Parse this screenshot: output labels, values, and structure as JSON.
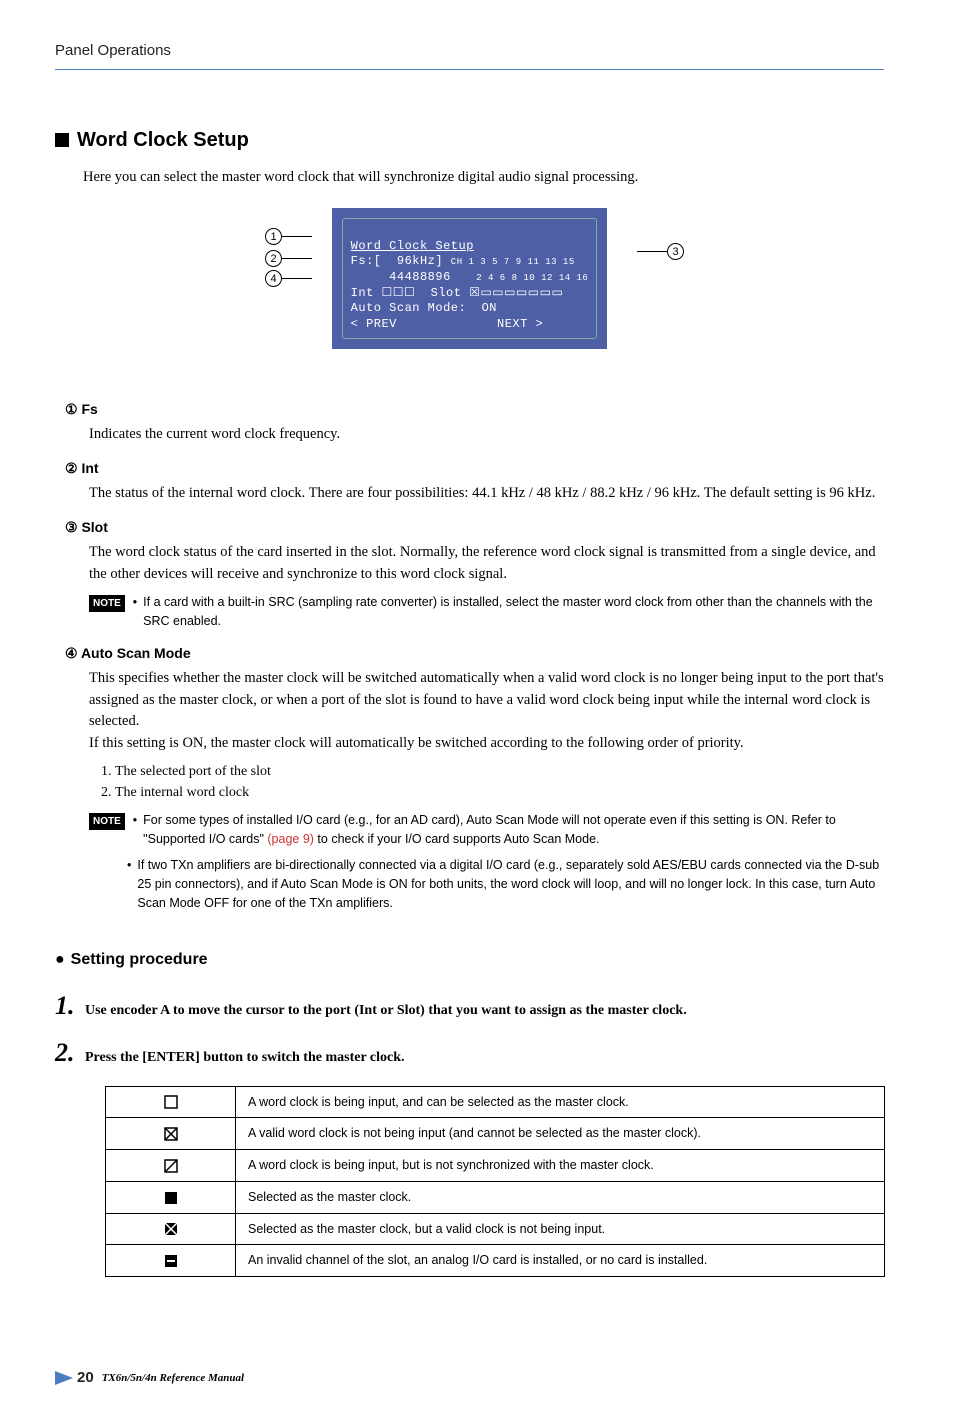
{
  "header": {
    "title": "Panel Operations"
  },
  "section": {
    "title": "Word Clock Setup",
    "intro": "Here you can select the master word clock that will synchronize digital audio signal processing."
  },
  "lcd": {
    "line1": "Word Clock Setup",
    "line2": "Fs:[  96kHz]",
    "line3a": "     44488896 ",
    "line3b_top": "CH 1 3 5 7 9 11 13 15",
    "line3b_bot": "   2 4 6 8 10 12 14 16",
    "line4a": "Int ☐☐☐",
    "line4b": "Slot ☒▭▭▭▭▭▭▭",
    "line5": "Auto Scan Mode:  ON ",
    "line6a": "< PREV",
    "line6b": "NEXT >"
  },
  "items": [
    {
      "num": "①",
      "label": "Fs",
      "body": "Indicates the current word clock frequency."
    },
    {
      "num": "②",
      "label": "Int",
      "body": "The status of the internal word clock. There are four possibilities: 44.1 kHz / 48 kHz / 88.2 kHz / 96 kHz. The default setting is 96 kHz."
    },
    {
      "num": "③",
      "label": "Slot",
      "body": "The word clock status of the card inserted in the slot. Normally, the reference word clock signal is transmitted from a single device, and the other devices will receive and synchronize to this word clock signal.",
      "note1": "If a card with a built-in SRC (sampling rate converter) is installed, select the master word clock from other than the channels with the SRC enabled."
    },
    {
      "num": "④",
      "label": "Auto Scan Mode",
      "body1": "This specifies whether the master clock will be switched automatically when a valid word clock is no longer being input to the port that's assigned as the master clock, or when a port of the slot is found to have a valid word clock being input while the internal word clock is selected.",
      "body2": "If this setting is ON, the master clock will automatically be switched according to the following order of priority.",
      "ol1": "The selected port of the slot",
      "ol2": "The internal word clock",
      "noteA_pre": "For some types of installed I/O card (e.g., for an AD card), Auto Scan Mode will not operate even if this setting is ON. Refer to \"Supported I/O cards\" ",
      "noteA_link": "(page 9)",
      "noteA_post": " to check if your I/O card supports Auto Scan Mode.",
      "noteB": "If two TXn amplifiers are bi-directionally connected via a digital I/O card (e.g., separately sold AES/EBU cards connected via the D-sub 25 pin connectors), and if Auto Scan Mode is ON for both units, the word clock will loop, and will no longer lock. In this case, turn Auto Scan Mode OFF for one of the TXn amplifiers."
    }
  ],
  "procedure": {
    "title": "Setting procedure",
    "step1": "Use encoder A to move the cursor to the port (Int or Slot) that you want to assign as the master clock.",
    "step2": "Press the [ENTER] button to switch the master clock."
  },
  "legend": [
    {
      "icon": "box-empty",
      "desc": "A word clock is being input, and can be selected as the master clock."
    },
    {
      "icon": "box-x",
      "desc": "A valid word clock is not being input (and cannot be selected as the master clock)."
    },
    {
      "icon": "box-diag",
      "desc": "A word clock is being input, but is not synchronized with the master clock."
    },
    {
      "icon": "box-fill",
      "desc": "Selected as the master clock."
    },
    {
      "icon": "box-fill-x",
      "desc": "Selected as the master clock, but a valid clock is not being input."
    },
    {
      "icon": "box-fill-dash",
      "desc": "An invalid channel of the slot, an analog I/O card is installed, or no card is installed."
    }
  ],
  "footer": {
    "page": "20",
    "ref": "TX6n/5n/4n  Reference Manual"
  }
}
